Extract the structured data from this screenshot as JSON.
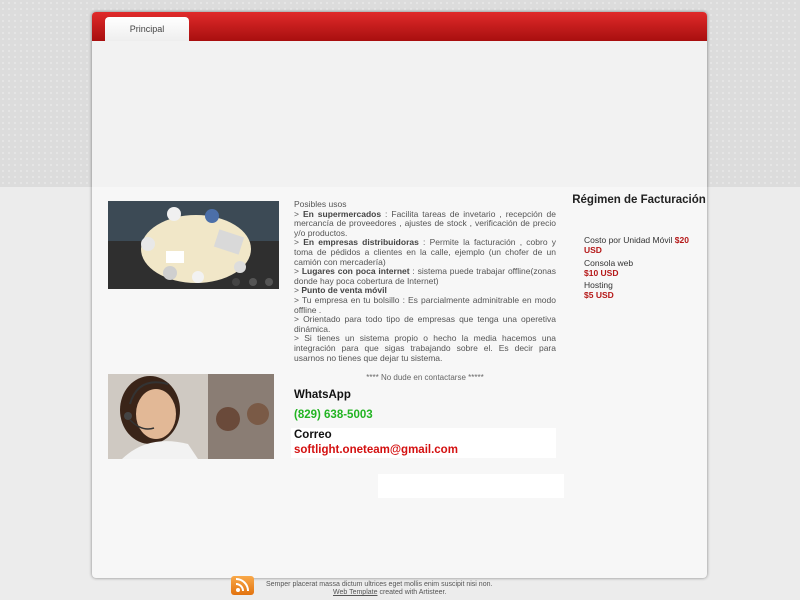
{
  "nav": {
    "tab_label": "Principal"
  },
  "content": {
    "heading": "Posibles usos",
    "items": [
      {
        "prefix": "> ",
        "bold": "En supermercados",
        "rest": " : Facilita tareas de invetario , recepción de mercancía de proveedores , ajustes de stock , verificación de precio y/o productos."
      },
      {
        "prefix": "> ",
        "bold": "En empresas distribuidoras",
        "rest": " : Permite la facturación , cobro y toma de pédidos a clientes en la calle, ejemplo (un chofer de un camión con mercadería)"
      },
      {
        "prefix": "> ",
        "bold": "Lugares con poca internet",
        "rest": " : sistema puede trabajar offline(zonas donde hay poca cobertura de Internet)"
      },
      {
        "prefix": "> ",
        "bold": "Punto de venta móvil",
        "rest": ""
      },
      {
        "prefix": "",
        "bold": "",
        "rest": "> Tu empresa en tu bolsillo : Es parcialmente adminitrable en modo offline ."
      },
      {
        "prefix": "",
        "bold": "",
        "rest": "> Orientado para todo tipo de empresas que tenga una operetiva dinámica."
      },
      {
        "prefix": "",
        "bold": "",
        "rest": "> Si tienes un sistema propio o hecho la media hacemos una integración para que sigas trabajando sobre el. Es decir para usarnos no tienes que dejar tu sistema."
      }
    ]
  },
  "contact": {
    "title": "**** No dude en contactarse *****",
    "whatsapp_label": "WhatsApp",
    "whatsapp_number": "(829) 638-5003",
    "email_label": "Correo",
    "email": "softlight.oneteam@gmail.com"
  },
  "sidebar": {
    "title": "Régimen de Facturación",
    "plans": [
      {
        "name": "Costo por Unidad Móvil",
        "price": "$20 USD"
      },
      {
        "name": "Consola web",
        "price": "$10 USD"
      },
      {
        "name": "Hosting",
        "price": "$5 USD"
      }
    ]
  },
  "footer": {
    "text": "Semper placerat massa dictum ultrices eget mollis enim suscipit nisi non.",
    "link_text": "Web Template",
    "credit_text": " created with Artisteer."
  },
  "colors": {
    "top_bar": "#c41a1a",
    "price": "#b51818",
    "phone": "#22b422",
    "email": "#d41010"
  },
  "icons": {
    "feed": "rss-icon"
  }
}
